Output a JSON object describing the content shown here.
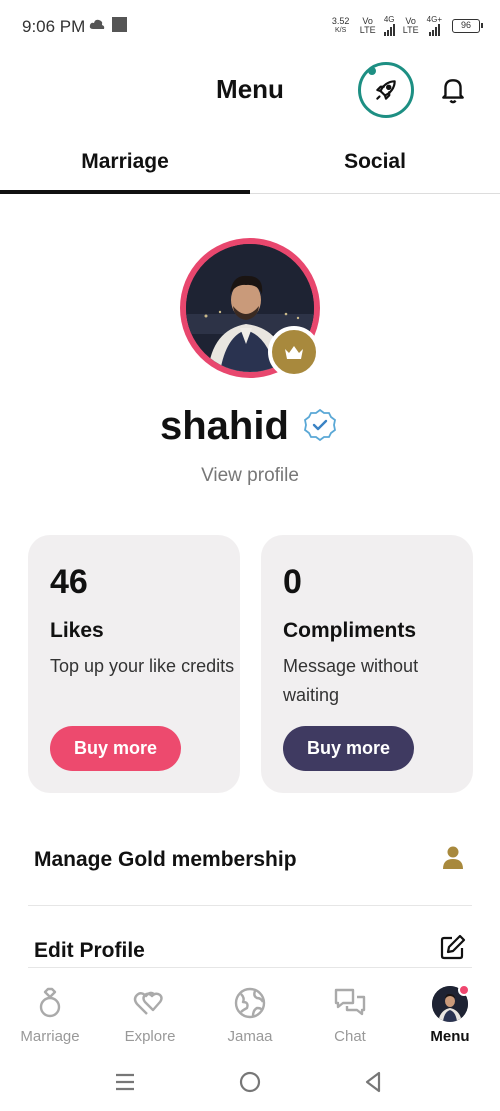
{
  "status_bar": {
    "time": "9:06 PM",
    "speed": "3.52",
    "speed_unit": "K/S",
    "net1": "Vo\nLTE",
    "net1_type": "4G",
    "net2": "Vo\nLTE",
    "net2_type": "4G+",
    "battery": "96"
  },
  "header": {
    "title": "Menu",
    "boost_icon": "rocket-icon",
    "notification_icon": "bell-icon"
  },
  "tabs": [
    {
      "label": "Marriage",
      "active": true
    },
    {
      "label": "Social",
      "active": false
    }
  ],
  "profile": {
    "name": "shahid",
    "view_profile": "View profile",
    "verified_icon": "verified-badge-icon",
    "crown_icon": "crown-icon"
  },
  "cards": {
    "likes": {
      "count": "46",
      "title": "Likes",
      "desc": "Top up your like credits",
      "button": "Buy more"
    },
    "compliments": {
      "count": "0",
      "title": "Compliments",
      "desc": "Message without waiting",
      "button": "Buy more"
    }
  },
  "menu": {
    "gold": {
      "label": "Manage Gold membership",
      "icon": "person-icon"
    },
    "edit": {
      "label": "Edit Profile",
      "icon": "edit-icon"
    }
  },
  "bottom_nav": [
    {
      "label": "Marriage",
      "icon": "ring-icon"
    },
    {
      "label": "Explore",
      "icon": "hearts-icon"
    },
    {
      "label": "Jamaa",
      "icon": "globe-icon"
    },
    {
      "label": "Chat",
      "icon": "chat-icon"
    },
    {
      "label": "Menu",
      "icon": "avatar",
      "active": true
    }
  ],
  "colors": {
    "accent_pink": "#ed4a6e",
    "accent_purple": "#3f3a61",
    "gold": "#a8893d",
    "teal": "#1d8f83"
  }
}
